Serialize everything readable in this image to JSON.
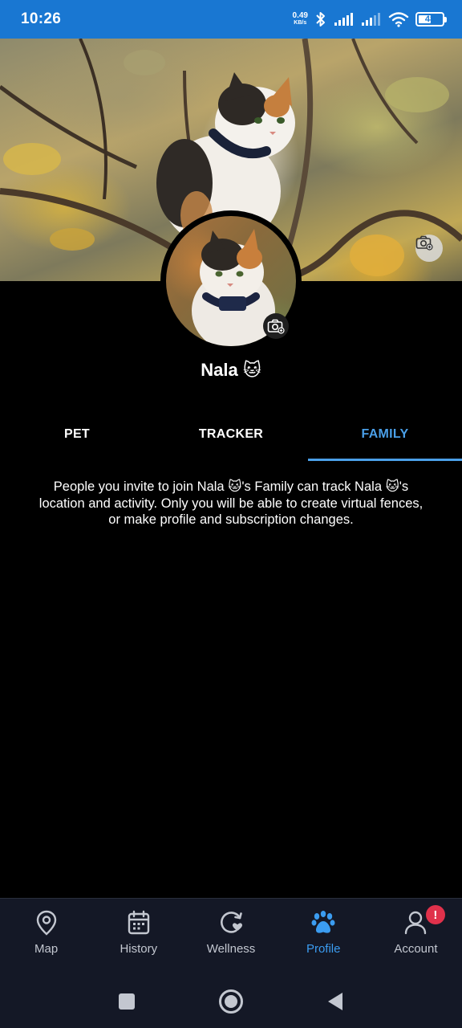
{
  "status_bar": {
    "time": "10:26",
    "net_speed_value": "0.49",
    "net_speed_unit": "KB/s",
    "battery_level": "48",
    "icons": [
      "bluetooth-icon",
      "signal-icon",
      "signal-icon",
      "wifi-icon",
      "battery-icon"
    ]
  },
  "profile": {
    "pet_name": "Nala 🐱",
    "cover_camera_icon": "camera-icon",
    "avatar_camera_icon": "camera-icon"
  },
  "tabs": [
    {
      "label": "PET",
      "active": false
    },
    {
      "label": "TRACKER",
      "active": false
    },
    {
      "label": "FAMILY",
      "active": true
    }
  ],
  "family": {
    "description": "People you invite to join Nala 🐱's Family can track Nala 🐱's location and activity. Only you will be able to create virtual fences, or make profile and subscription changes."
  },
  "bottom_nav": {
    "items": [
      {
        "label": "Map",
        "icon": "map-pin-icon",
        "active": false
      },
      {
        "label": "History",
        "icon": "calendar-icon",
        "active": false
      },
      {
        "label": "Wellness",
        "icon": "wellness-icon",
        "active": false
      },
      {
        "label": "Profile",
        "icon": "paw-icon",
        "active": true
      },
      {
        "label": "Account",
        "icon": "user-icon",
        "active": false,
        "badge": "!"
      }
    ]
  },
  "system_nav": {
    "icons": [
      "recents-square-icon",
      "home-circle-icon",
      "back-triangle-icon"
    ]
  },
  "colors": {
    "status_bar": "#1977d2",
    "accent": "#4a9fe8",
    "nav_background": "#141826",
    "badge": "#e0314b"
  }
}
